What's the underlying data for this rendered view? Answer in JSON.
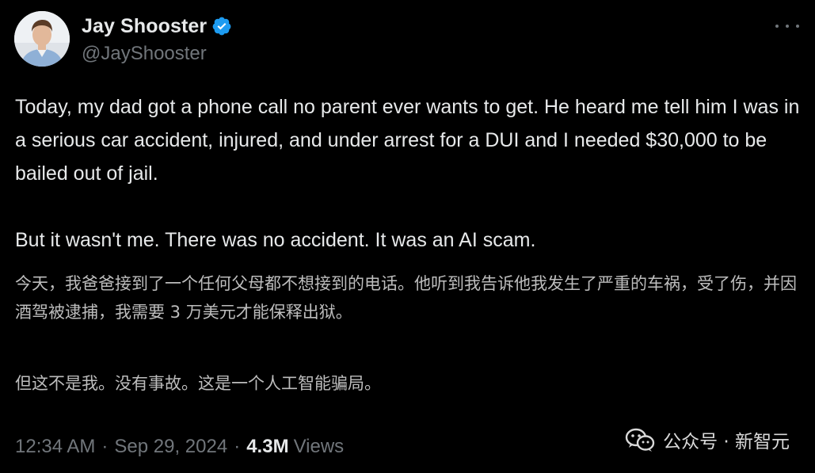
{
  "author": {
    "display_name": "Jay Shooster",
    "handle": "@JayShooster",
    "verified": true,
    "avatar_icon": "avatar-photo"
  },
  "tweet": {
    "text_en": {
      "p1": "Today, my dad got a phone call no parent ever wants to get. He heard me tell him I was in a serious car accident, injured, and under arrest for a DUI and I needed $30,000 to be bailed out of jail.",
      "p2": "But it wasn't me. There was no accident. It was an AI scam."
    },
    "text_zh": {
      "p1": "今天，我爸爸接到了一个任何父母都不想接到的电话。他听到我告诉他我发生了严重的车祸，受了伤，并因酒驾被逮捕，我需要 3 万美元才能保释出狱。",
      "p2": "但这不是我。没有事故。这是一个人工智能骗局。"
    },
    "time": "12:34 AM",
    "separator": "·",
    "date": "Sep 29, 2024",
    "views_count": "4.3M",
    "views_label": "Views"
  },
  "watermark": {
    "text": "公众号 · 新智元",
    "icon": "wechat-icon"
  },
  "colors": {
    "background": "#000000",
    "text_primary": "#e7e9ea",
    "text_secondary": "#71767b",
    "verified_blue": "#1d9bf0"
  }
}
